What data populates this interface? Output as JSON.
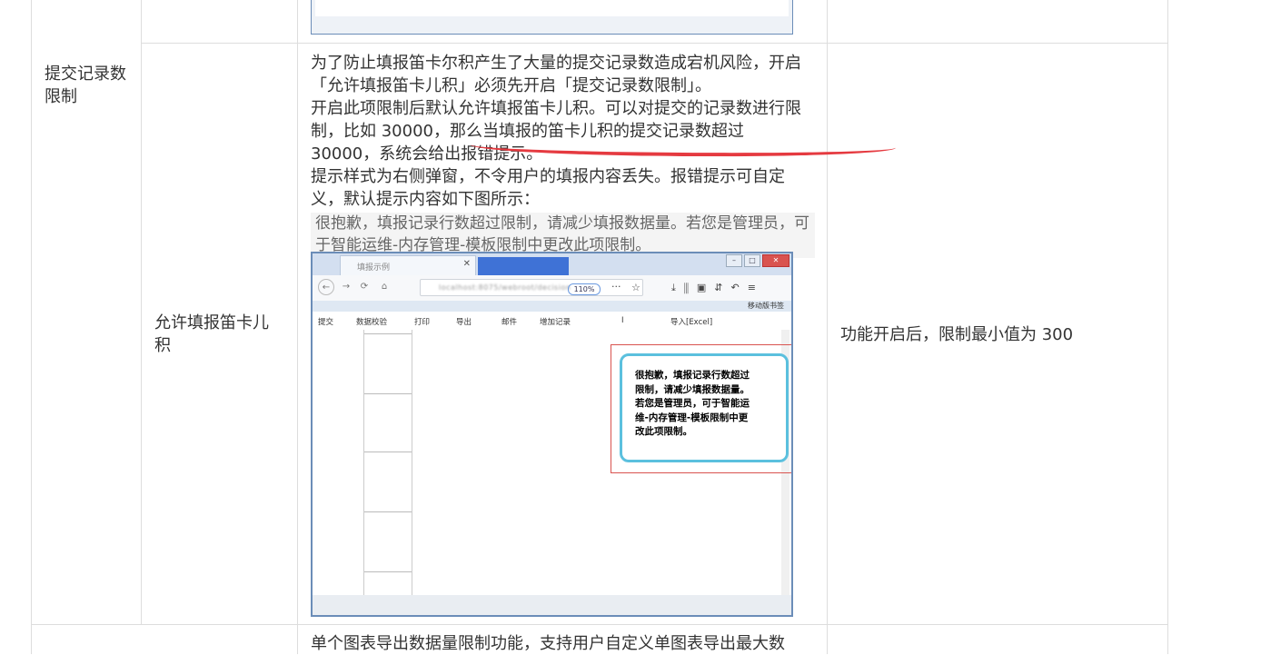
{
  "rows": {
    "row1": {
      "category": "提交记录数限制",
      "feature": "允许填报笛卡儿积",
      "description": [
        "为了防止填报笛卡尔积产生了大量的提交记录数造成宕机风险，开启「允许填报笛卡儿积」必须先开启「提交记录数限制」。",
        "开启此项限制后默认允许填报笛卡儿积。可以对提交的记录数进行限制，比如 30000，那么当填报的笛卡儿积的提交记录数超过 30000，系统会给出报错提示。",
        "提示样式为右侧弹窗，不令用户的填报内容丢失。报错提示可自定义，默认提示内容如下图所示："
      ],
      "default_message": "很抱歉，填报记录行数超过限制，请减少填报数据量。若您是管理员，可于智能运维-内存管理-模板限制中更改此项限制。",
      "note": "功能开启后，限制最小值为 300"
    },
    "row2": {
      "description_start": "单个图表导出数据量限制功能，支持用户自定义单图表导出最大数"
    }
  },
  "screenshot": {
    "tab_title": "填报示例",
    "url": "localhost:8075/webroot/decision",
    "zoom": "110%",
    "more": "···",
    "bookmark": "移动版书签",
    "toolbar": {
      "submit": "提交",
      "verify": "数据校验",
      "print": "打印",
      "export": "导出",
      "mail": "邮件",
      "add_record": "增加记录",
      "import_excel": "导入[Excel]",
      "marker": "I"
    },
    "popup_message": "很抱歉，填报记录行数超过限制，请减少填报数据量。若您是管理员，可于智能运维-内存管理-模板限制中更改此项限制。"
  }
}
